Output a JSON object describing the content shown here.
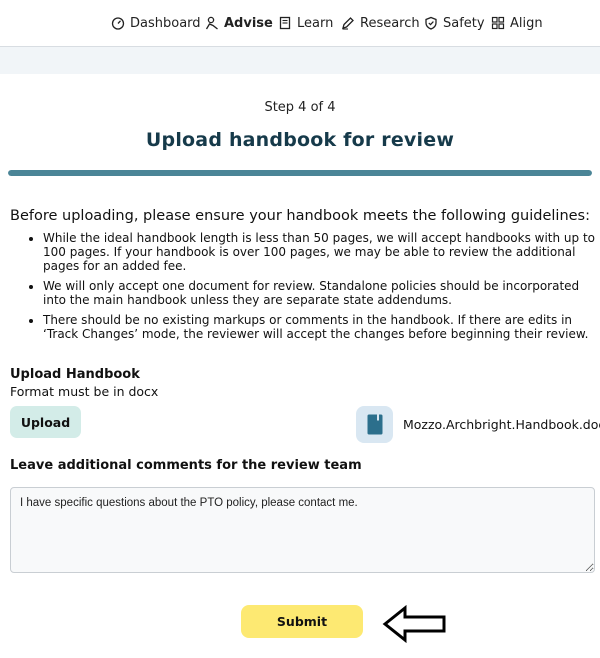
{
  "nav": {
    "items": [
      {
        "label": "Dashboard",
        "icon": "gauge-icon"
      },
      {
        "label": "Advise",
        "icon": "advisor-icon",
        "active": true
      },
      {
        "label": "Learn",
        "icon": "book-icon"
      },
      {
        "label": "Research",
        "icon": "pen-icon"
      },
      {
        "label": "Safety",
        "icon": "shield-icon"
      },
      {
        "label": "Align",
        "icon": "grid-icon"
      }
    ]
  },
  "wizard": {
    "step_label": "Step 4 of 4",
    "title": "Upload handbook for review",
    "progress_fraction": 1.0,
    "accent_color": "#4b8597"
  },
  "guidelines": {
    "intro": "Before uploading, please ensure your handbook meets the following guidelines:",
    "items": [
      "While the ideal handbook length is less than 50 pages, we will accept handbooks with up to 100 pages. If your handbook is over 100 pages, we may be able to review the additional pages for an added fee.",
      "We will only accept one document for review. Standalone policies should be incorporated into the main handbook unless they are separate state addendums.",
      "There should be no existing markups or comments in the handbook. If there are edits in ‘Track Changes’ mode, the reviewer will accept the changes before beginning their review."
    ]
  },
  "upload": {
    "title": "Upload Handbook",
    "format_note": "Format must be in docx",
    "button_label": "Upload",
    "file_name": "Mozzo.Archbright.Handbook.docx",
    "file_icon": "document-icon"
  },
  "comments": {
    "label": "Leave additional comments for the review team",
    "value": "I have specific questions about the PTO policy, please contact me."
  },
  "submit": {
    "label": "Submit",
    "color": "#fde972"
  }
}
